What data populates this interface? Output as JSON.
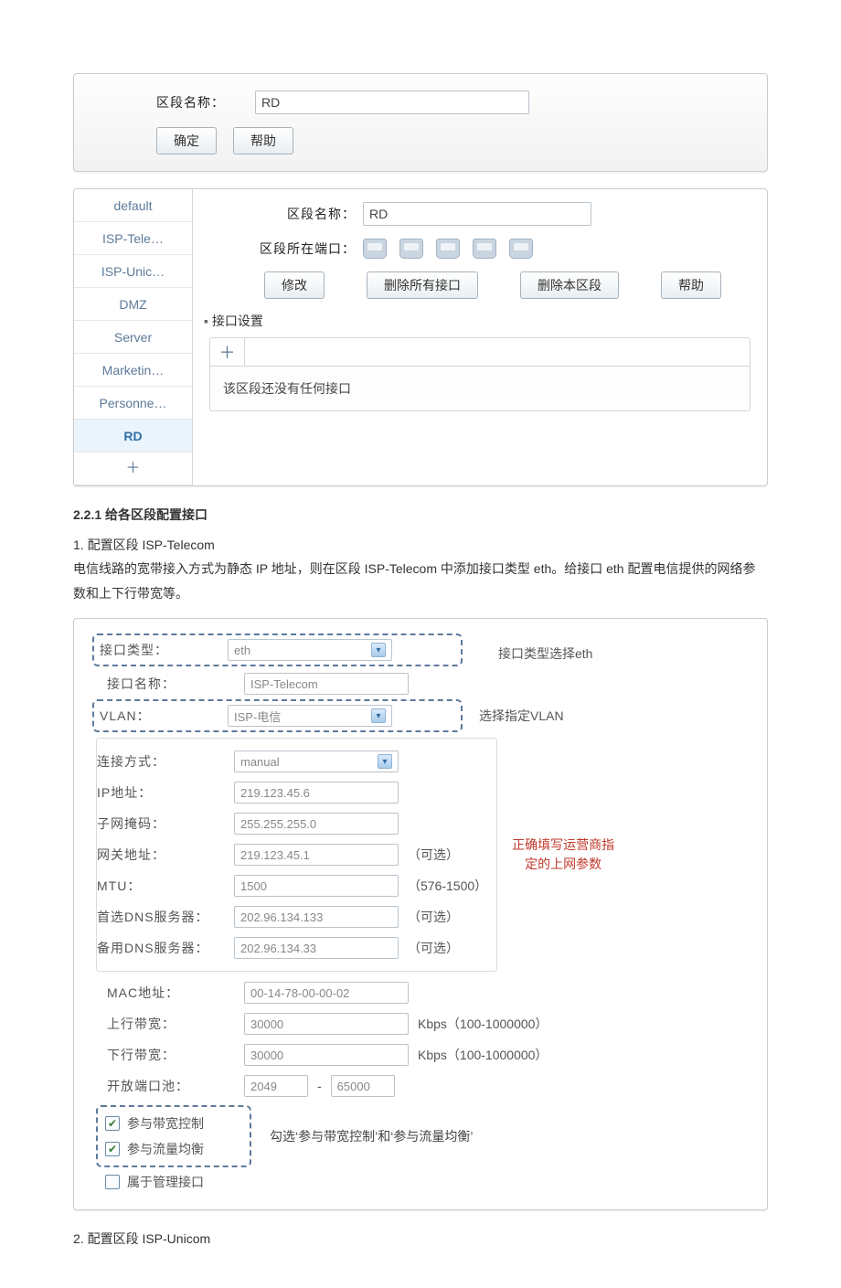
{
  "panel1": {
    "name_label": "区段名称：",
    "name_value": "RD",
    "btn_ok": "确定",
    "btn_help": "帮助"
  },
  "zones": {
    "items": [
      {
        "label": "default"
      },
      {
        "label": "ISP-Tele…"
      },
      {
        "label": "ISP-Unic…"
      },
      {
        "label": "DMZ"
      },
      {
        "label": "Server"
      },
      {
        "label": "Marketin…"
      },
      {
        "label": "Personne…"
      },
      {
        "label": "RD"
      }
    ],
    "add": "＋"
  },
  "zone_detail": {
    "name_label": "区段名称：",
    "name_value": "RD",
    "port_label": "区段所在端口：",
    "btn_modify": "修改",
    "btn_del_if": "删除所有接口",
    "btn_del_zone": "删除本区段",
    "btn_help": "帮助",
    "section": "接口设置",
    "tab_add": "＋",
    "empty_msg": "该区段还没有任何接口"
  },
  "doc": {
    "h3": "2.2.1 给各区段配置接口",
    "line1": "1. 配置区段 ISP-Telecom",
    "para1": "电信线路的宽带接入方式为静态 IP 地址，则在区段 ISP-Telecom 中添加接口类型 eth。给接口 eth 配置电信提供的网络参数和上下行带宽等。",
    "line2": "2. 配置区段 ISP-Unicom"
  },
  "form": {
    "if_type_label": "接口类型：",
    "if_type_value": "eth",
    "if_type_hint": "接口类型选择eth",
    "if_name_label": "接口名称：",
    "if_name_value": "ISP-Telecom",
    "vlan_label": "VLAN：",
    "vlan_value": "ISP-电信",
    "vlan_hint": "选择指定VLAN",
    "conn_label": "连接方式：",
    "conn_value": "manual",
    "ip_label": "IP地址：",
    "ip_value": "219.123.45.6",
    "mask_label": "子网掩码：",
    "mask_value": "255.255.255.0",
    "gw_label": "网关地址：",
    "gw_value": "219.123.45.1",
    "gw_opt": "（可选）",
    "mtu_label": "MTU：",
    "mtu_value": "1500",
    "mtu_range": "（576-1500）",
    "dns1_label": "首选DNS服务器：",
    "dns1_value": "202.96.134.133",
    "dns1_opt": "（可选）",
    "dns2_label": "备用DNS服务器：",
    "dns2_value": "202.96.134.33",
    "dns2_opt": "（可选）",
    "note_right": "正确填写运营商指定的上网参数",
    "mac_label": "MAC地址：",
    "mac_value": "00-14-78-00-00-02",
    "up_label": "上行带宽：",
    "up_value": "30000",
    "up_unit": "Kbps（100-1000000）",
    "down_label": "下行带宽：",
    "down_value": "30000",
    "down_unit": "Kbps（100-1000000）",
    "pool_label": "开放端口池：",
    "pool_from": "2049",
    "pool_dash": "-",
    "pool_to": "65000",
    "cb1": "参与带宽控制",
    "cb2": "参与流量均衡",
    "cb3": "属于管理接口",
    "cb_hint": "勾选‘参与带宽控制’和‘参与流量均衡’"
  }
}
